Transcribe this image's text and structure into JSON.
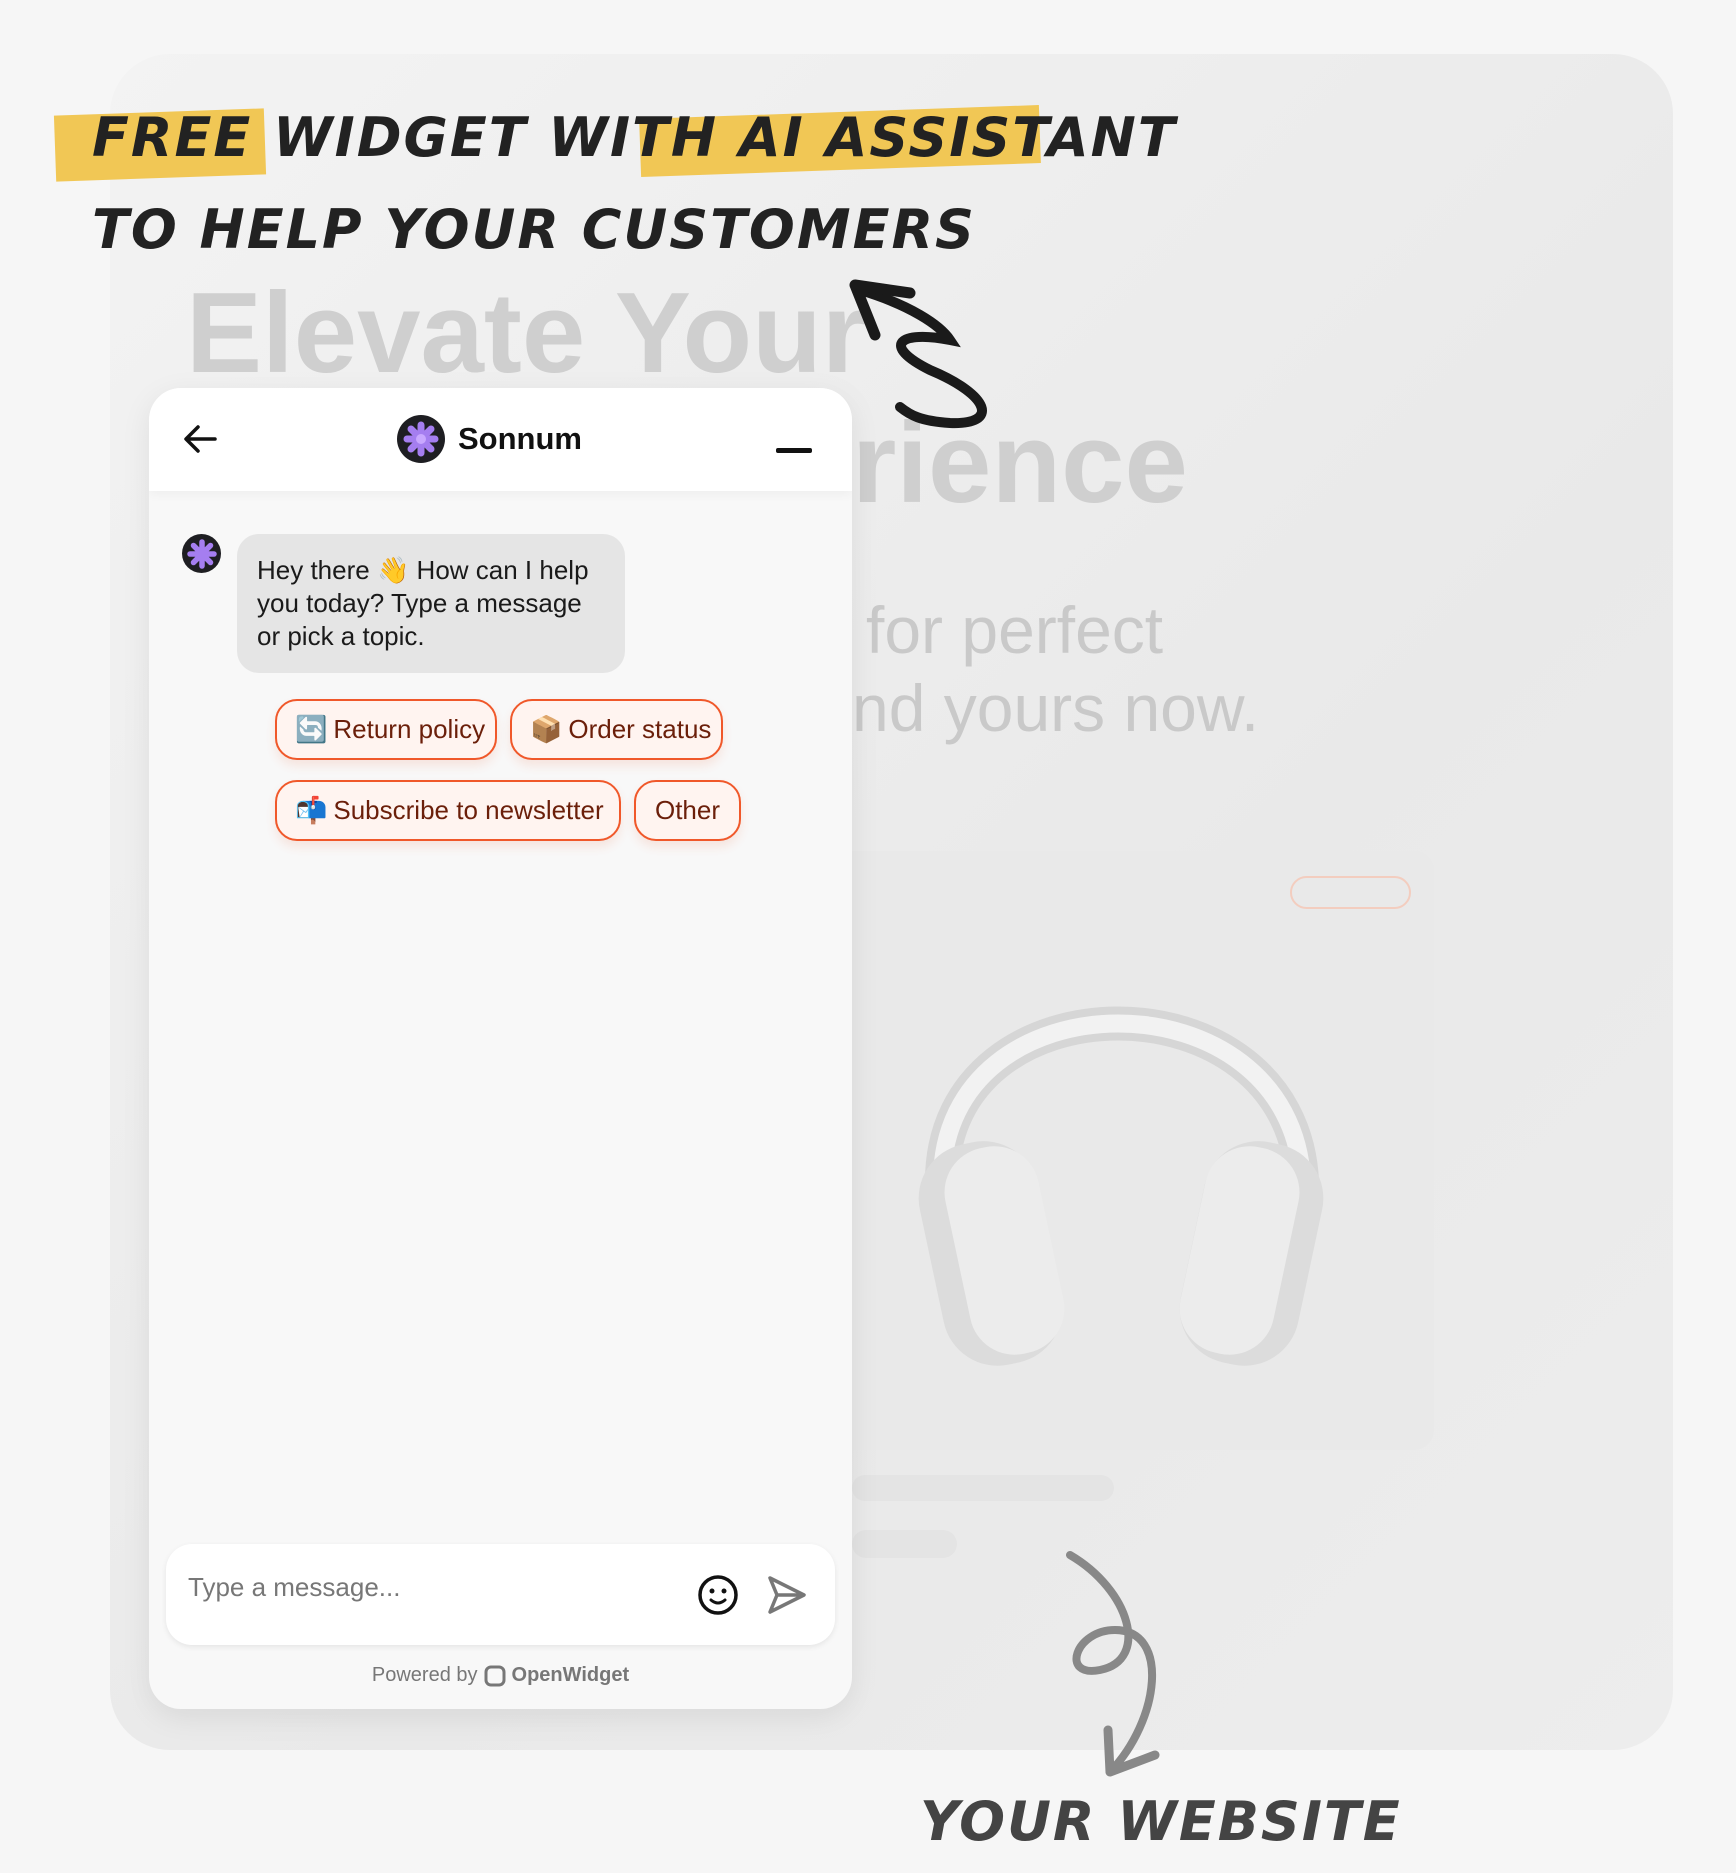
{
  "annotation": {
    "line1_parts": [
      "FREE",
      "WIDGET WITH",
      "AI ASSISTANT"
    ],
    "line2": "TO HELP YOUR CUSTOMERS",
    "bottom_label": "YOUR WEBSITE",
    "highlight_color": "#f1c244"
  },
  "website": {
    "hero_line1": "Elevate Your",
    "hero_line2": "rience",
    "sub_line1": "for perfect",
    "sub_line2": "nd yours now."
  },
  "widget": {
    "title": "Sonnum",
    "back_icon": "arrow-left-icon",
    "minimize_icon": "minus-icon",
    "greeting": "Hey there 👋 How can I help you today? Type a message or pick a topic.",
    "chips": [
      {
        "emoji": "🔄",
        "label": "Return policy"
      },
      {
        "emoji": "📦",
        "label": "Order status"
      },
      {
        "emoji": "📬",
        "label": "Subscribe to newsletter"
      },
      {
        "emoji": "",
        "label": "Other"
      }
    ],
    "input_placeholder": "Type a message...",
    "powered_prefix": "Powered by",
    "powered_brand": "OpenWidget",
    "accent_color": "#f0582a"
  }
}
